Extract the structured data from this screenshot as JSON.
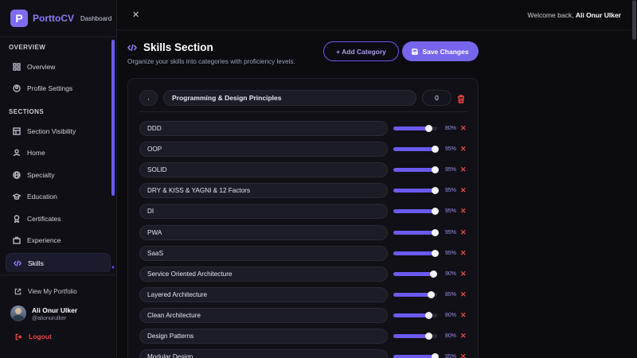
{
  "brand": {
    "logo_letter": "P",
    "name": "PorttoCV",
    "sub": "Dashboard"
  },
  "sidebar": {
    "section_overview": "OVERVIEW",
    "section_sections": "SECTIONS",
    "items": [
      {
        "label": "Overview",
        "icon": "grid-icon"
      },
      {
        "label": "Profile Settings",
        "icon": "user-circle-icon"
      },
      {
        "label": "Section Visibility",
        "icon": "layout-icon"
      },
      {
        "label": "Home",
        "icon": "user-icon"
      },
      {
        "label": "Specialty",
        "icon": "globe-icon"
      },
      {
        "label": "Education",
        "icon": "graduation-cap-icon"
      },
      {
        "label": "Certificates",
        "icon": "award-icon"
      },
      {
        "label": "Experience",
        "icon": "briefcase-icon"
      },
      {
        "label": "Skills",
        "icon": "code-icon",
        "active": true
      }
    ],
    "view_portfolio": "View My Portfolio",
    "user": {
      "name": "Ali Onur Ulker",
      "handle": "@alionurulker"
    },
    "logout": "Logout"
  },
  "topbar": {
    "close": "✕",
    "welcome_prefix": "Welcome back,",
    "welcome_name": "Ali Onur Ulker"
  },
  "header": {
    "title": "Skills Section",
    "subtitle": "Organize your skills into categories with proficiency levels.",
    "add_category": "+ Add Category",
    "save_changes": "Save Changes"
  },
  "category": {
    "key": ",",
    "name": "Programming & Design Principles",
    "order": "0"
  },
  "skills": [
    {
      "name": "DDD",
      "level": 80,
      "pct": "80%"
    },
    {
      "name": "OOP",
      "level": 95,
      "pct": "95%"
    },
    {
      "name": "SOLID",
      "level": 95,
      "pct": "95%"
    },
    {
      "name": "DRY & KISS & YAGNI & 12 Factors",
      "level": 95,
      "pct": "95%"
    },
    {
      "name": "DI",
      "level": 95,
      "pct": "95%"
    },
    {
      "name": "PWA",
      "level": 95,
      "pct": "95%"
    },
    {
      "name": "SaaS",
      "level": 95,
      "pct": "95%"
    },
    {
      "name": "Service Oriented Architecture",
      "level": 90,
      "pct": "90%"
    },
    {
      "name": "Layered Architecture",
      "level": 85,
      "pct": "85%"
    },
    {
      "name": "Clean Architecture",
      "level": 80,
      "pct": "80%"
    },
    {
      "name": "Design Patterns",
      "level": 80,
      "pct": "80%"
    },
    {
      "name": "Modular Design",
      "level": 95,
      "pct": "95%"
    }
  ],
  "colors": {
    "accent": "#7566ec",
    "danger": "#ef4444",
    "background": "#0b0b10"
  }
}
